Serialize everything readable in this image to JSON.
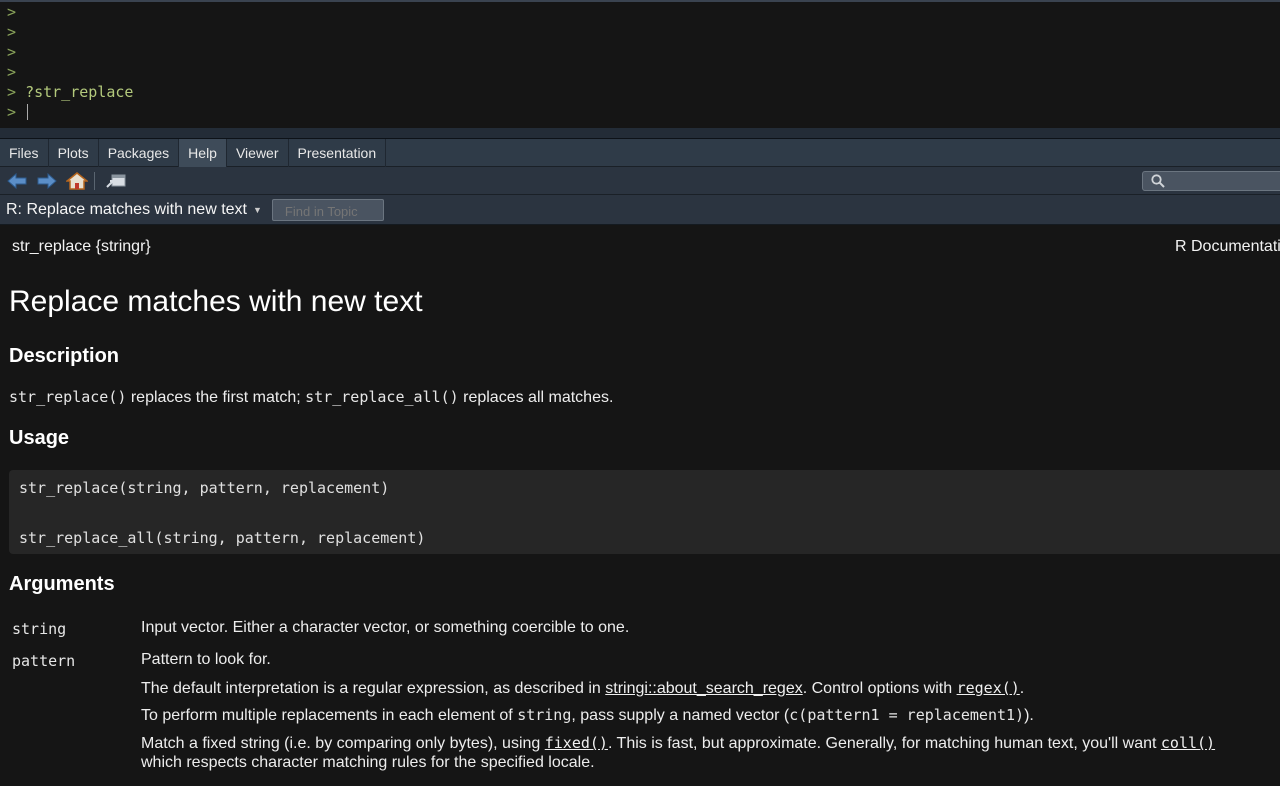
{
  "console": {
    "prompt": ">",
    "lines": [
      "",
      "",
      "",
      "",
      "?str_replace",
      ""
    ]
  },
  "tabs": [
    {
      "label": "Files",
      "active": false
    },
    {
      "label": "Plots",
      "active": false
    },
    {
      "label": "Packages",
      "active": false
    },
    {
      "label": "Help",
      "active": true
    },
    {
      "label": "Viewer",
      "active": false
    },
    {
      "label": "Presentation",
      "active": false
    }
  ],
  "toolbar": {
    "icons": [
      "back-arrow-icon",
      "forward-arrow-icon",
      "home-icon",
      "popout-window-icon",
      "search-icon"
    ],
    "search_value": ""
  },
  "topic": {
    "title": "R: Replace matches with new text",
    "find_placeholder": "Find in Topic"
  },
  "doc": {
    "header_left": "str_replace {stringr}",
    "header_right": "R Documentation",
    "title": "Replace matches with new text",
    "description_heading": "Description",
    "description": {
      "code1": "str_replace()",
      "text1": " replaces the first match; ",
      "code2": "str_replace_all()",
      "text2": " replaces all matches."
    },
    "usage_heading": "Usage",
    "usage": [
      "str_replace(string, pattern, replacement)",
      "str_replace_all(string, pattern, replacement)"
    ],
    "arguments_heading": "Arguments",
    "args": {
      "string_name": "string",
      "string_desc": "Input vector. Either a character vector, or something coercible to one.",
      "pattern_name": "pattern",
      "pattern_desc1": "Pattern to look for.",
      "pattern_desc2a": "The default interpretation is a regular expression, as described in ",
      "pattern_desc2_link": "stringi::about_search_regex",
      "pattern_desc2b": ". Control options with ",
      "pattern_desc2_code": "regex()",
      "pattern_desc2c": ".",
      "pattern_desc3a": "To perform multiple replacements in each element of ",
      "pattern_desc3_code1": "string",
      "pattern_desc3b": ", pass supply a named vector (",
      "pattern_desc3_code2": "c(pattern1 = replacement1)",
      "pattern_desc3c": ").",
      "pattern_desc4a": "Match a fixed string (i.e. by comparing only bytes), using ",
      "pattern_desc4_code1": "fixed()",
      "pattern_desc4b": ". This is fast, but approximate. Generally, for matching human text, you'll want ",
      "pattern_desc4_code2": "coll()",
      "pattern_desc4c": "which respects character matching rules for the specified locale."
    }
  }
}
